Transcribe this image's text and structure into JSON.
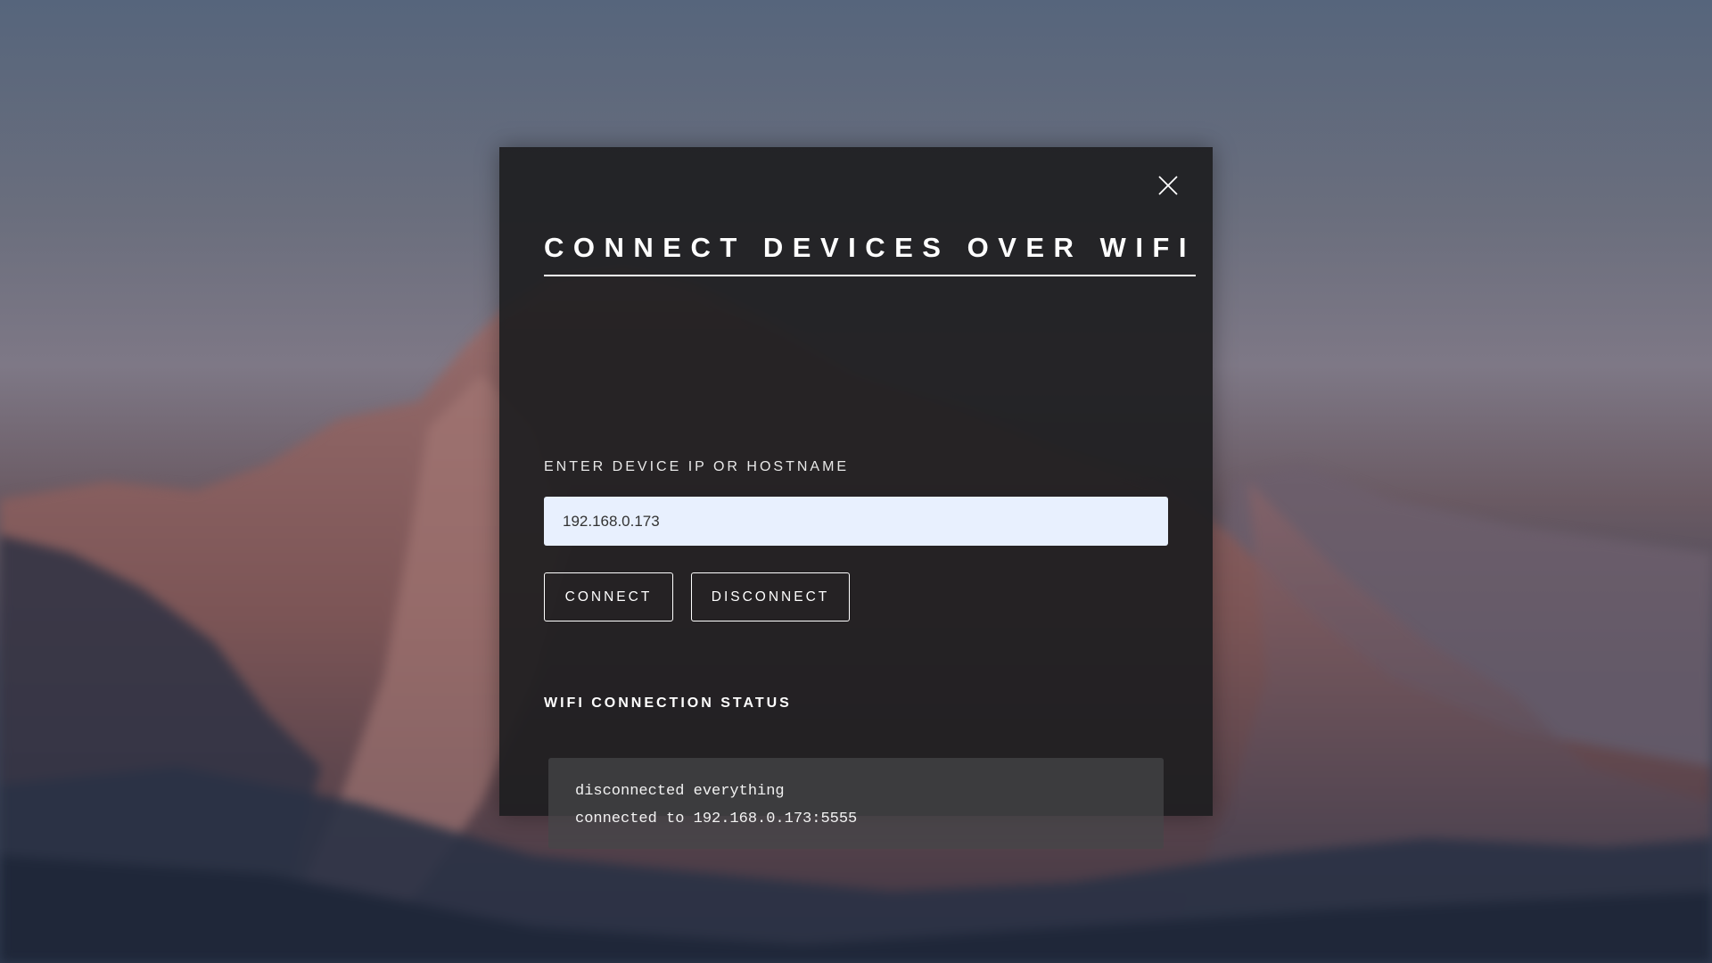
{
  "modal": {
    "title": "CONNECT DEVICES OVER WIFI",
    "close_icon": "close-icon",
    "field_label": "ENTER DEVICE IP OR HOSTNAME",
    "ip_input": {
      "value": "192.168.0.173",
      "placeholder": ""
    },
    "buttons": {
      "connect_label": "CONNECT",
      "disconnect_label": "DISCONNECT"
    },
    "status": {
      "heading": "WIFI CONNECTION STATUS",
      "lines": [
        "disconnected everything",
        "connected to 192.168.0.173:5555"
      ]
    }
  },
  "colors": {
    "modal_background": "#1e1e20",
    "input_background": "#e8f0fe",
    "text": "#ffffff"
  }
}
